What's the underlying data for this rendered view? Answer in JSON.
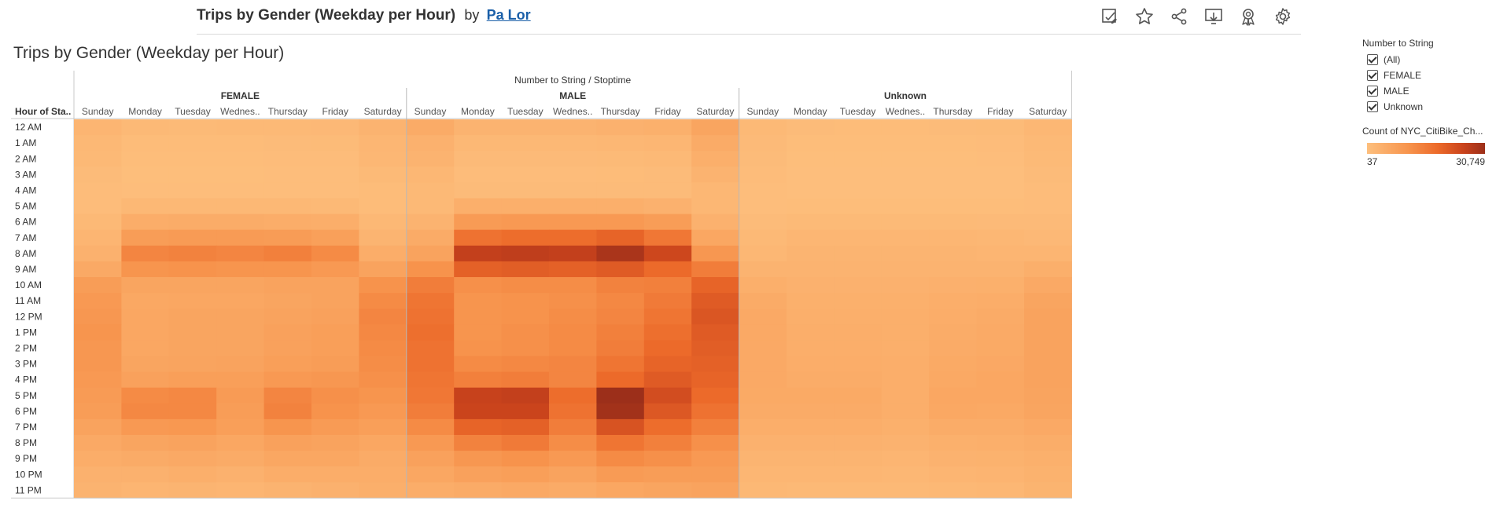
{
  "topbar": {
    "title": "Trips by Gender (Weekday per Hour)",
    "by": "by",
    "author": "Pa Lor"
  },
  "toolbar_icons": [
    "edit-sheet-icon",
    "star-icon",
    "share-icon",
    "download-icon",
    "metrics-icon",
    "settings-icon"
  ],
  "sheet_title": "Trips by Gender (Weekday per Hour)",
  "legend": {
    "filter_title": "Number to String",
    "items": [
      "(All)",
      "FEMALE",
      "MALE",
      "Unknown"
    ],
    "color_title": "Count of NYC_CitiBike_Ch...",
    "min_label": "37",
    "max_label": "30,749",
    "colors": [
      "#fdbf7d",
      "#f7944d",
      "#ec6a2a",
      "#c9431c",
      "#9c2f1a"
    ]
  },
  "chart_data": {
    "type": "heatmap",
    "column_header": "Number to String / Stoptime",
    "row_header": "Hour of Sta..",
    "groups": [
      "FEMALE",
      "MALE",
      "Unknown"
    ],
    "days": [
      "Sunday",
      "Monday",
      "Tuesday",
      "Wednes..",
      "Thursday",
      "Friday",
      "Saturday"
    ],
    "hours": [
      "12 AM",
      "1 AM",
      "2 AM",
      "3 AM",
      "4 AM",
      "5 AM",
      "6 AM",
      "7 AM",
      "8 AM",
      "9 AM",
      "10 AM",
      "11 AM",
      "12 PM",
      "1 PM",
      "2 PM",
      "3 PM",
      "4 PM",
      "5 PM",
      "6 PM",
      "7 PM",
      "8 PM",
      "9 PM",
      "10 PM",
      "11 PM"
    ],
    "color_range": [
      37,
      30749
    ],
    "values": {
      "FEMALE": [
        [
          2500,
          1500,
          1400,
          1500,
          1600,
          1700,
          3000
        ],
        [
          1800,
          900,
          900,
          900,
          1000,
          1100,
          2300
        ],
        [
          1500,
          600,
          600,
          600,
          700,
          800,
          2000
        ],
        [
          1000,
          400,
          400,
          400,
          450,
          500,
          1400
        ],
        [
          700,
          500,
          500,
          500,
          500,
          500,
          900
        ],
        [
          700,
          1800,
          1800,
          1800,
          1800,
          1600,
          900
        ],
        [
          1500,
          4500,
          4800,
          4700,
          4500,
          4200,
          1800
        ],
        [
          2500,
          8500,
          9000,
          9000,
          8800,
          7800,
          2800
        ],
        [
          3500,
          13500,
          14000,
          13500,
          14500,
          12500,
          4500
        ],
        [
          5500,
          10500,
          11000,
          10500,
          10500,
          9500,
          7000
        ],
        [
          8500,
          6500,
          6500,
          6500,
          7000,
          7000,
          11000
        ],
        [
          9500,
          5800,
          6000,
          6000,
          6500,
          7000,
          12500
        ],
        [
          10000,
          6000,
          6500,
          6500,
          7000,
          7500,
          13500
        ],
        [
          10500,
          6000,
          6500,
          6500,
          7500,
          8000,
          13000
        ],
        [
          10000,
          6000,
          6500,
          6500,
          7500,
          8000,
          12500
        ],
        [
          10000,
          6500,
          6800,
          7000,
          8000,
          8500,
          12000
        ],
        [
          9500,
          7500,
          8000,
          8000,
          9500,
          10000,
          11500
        ],
        [
          9000,
          12500,
          13000,
          9000,
          13500,
          11500,
          10500
        ],
        [
          8500,
          13000,
          13000,
          8500,
          14000,
          11000,
          9500
        ],
        [
          7000,
          9500,
          9800,
          8000,
          10500,
          9000,
          8000
        ],
        [
          5500,
          6500,
          7000,
          6000,
          7500,
          7000,
          6000
        ],
        [
          4500,
          5000,
          5500,
          5000,
          6000,
          6000,
          5000
        ],
        [
          3500,
          3500,
          4000,
          3500,
          4500,
          4500,
          4500
        ],
        [
          3000,
          2500,
          2800,
          2500,
          3000,
          3500,
          4000
        ]
      ],
      "MALE": [
        [
          5000,
          3000,
          3000,
          3000,
          3500,
          3800,
          6500
        ],
        [
          3500,
          1800,
          1800,
          1800,
          2000,
          2200,
          5000
        ],
        [
          3000,
          1200,
          1200,
          1200,
          1300,
          1500,
          4000
        ],
        [
          2000,
          800,
          800,
          800,
          900,
          1000,
          3000
        ],
        [
          1500,
          1000,
          1000,
          1000,
          1000,
          1000,
          2000
        ],
        [
          1500,
          4000,
          4000,
          4000,
          4000,
          3500,
          2000
        ],
        [
          3000,
          9000,
          9500,
          9500,
          9500,
          8500,
          3500
        ],
        [
          5000,
          17000,
          18000,
          18000,
          19500,
          16000,
          6000
        ],
        [
          7000,
          26000,
          26500,
          26000,
          29000,
          24500,
          10000
        ],
        [
          11000,
          20000,
          20500,
          20000,
          21000,
          18500,
          15000
        ],
        [
          15000,
          11500,
          12000,
          12000,
          14000,
          14500,
          19500
        ],
        [
          16500,
          10500,
          11000,
          11500,
          13000,
          15500,
          21000
        ],
        [
          17000,
          10500,
          11000,
          12000,
          13500,
          16500,
          22000
        ],
        [
          17500,
          10500,
          11500,
          12500,
          14500,
          17500,
          21000
        ],
        [
          17000,
          11000,
          11500,
          12500,
          15000,
          18500,
          20500
        ],
        [
          17000,
          12500,
          13000,
          13500,
          16500,
          19500,
          20000
        ],
        [
          16500,
          14500,
          15000,
          13500,
          18500,
          21000,
          19500
        ],
        [
          16000,
          25500,
          26000,
          18000,
          30749,
          23500,
          18500
        ],
        [
          15000,
          25000,
          25000,
          17000,
          30000,
          21500,
          17000
        ],
        [
          12500,
          19500,
          20000,
          15000,
          22500,
          18000,
          14500
        ],
        [
          9500,
          14000,
          15500,
          12000,
          16500,
          14500,
          11500
        ],
        [
          7500,
          10000,
          11000,
          9500,
          12500,
          11500,
          9500
        ],
        [
          6000,
          7500,
          8000,
          7000,
          9000,
          8500,
          8500
        ],
        [
          4500,
          5000,
          5500,
          5000,
          6000,
          6500,
          7000
        ]
      ],
      "Unknown": [
        [
          1600,
          1000,
          900,
          900,
          1000,
          1100,
          2000
        ],
        [
          1200,
          600,
          600,
          600,
          600,
          700,
          1500
        ],
        [
          1000,
          400,
          400,
          400,
          400,
          500,
          1300
        ],
        [
          700,
          300,
          300,
          300,
          300,
          350,
          1000
        ],
        [
          500,
          300,
          300,
          300,
          300,
          300,
          700
        ],
        [
          500,
          600,
          600,
          600,
          600,
          600,
          700
        ],
        [
          1000,
          1300,
          1300,
          1300,
          1300,
          1200,
          1200
        ],
        [
          1500,
          2200,
          2200,
          2200,
          2200,
          2000,
          1700
        ],
        [
          2000,
          2800,
          2800,
          2800,
          2800,
          2600,
          2500
        ],
        [
          3000,
          3000,
          3000,
          3000,
          3000,
          3000,
          4000
        ],
        [
          4000,
          3500,
          3500,
          3500,
          3700,
          3800,
          5500
        ],
        [
          5000,
          3800,
          3800,
          3800,
          4200,
          4500,
          6500
        ],
        [
          5500,
          4000,
          4000,
          4000,
          4500,
          5000,
          7000
        ],
        [
          5500,
          4200,
          4200,
          4000,
          4800,
          5200,
          7000
        ],
        [
          5500,
          4300,
          4300,
          4000,
          5000,
          5400,
          7000
        ],
        [
          5500,
          4500,
          4500,
          4200,
          5300,
          5700,
          7000
        ],
        [
          5500,
          4800,
          4800,
          4200,
          5600,
          6000,
          7000
        ],
        [
          5300,
          5300,
          5300,
          4400,
          6000,
          6000,
          6800
        ],
        [
          5000,
          5000,
          5000,
          4200,
          5800,
          5600,
          6500
        ],
        [
          4200,
          4300,
          4300,
          3800,
          4800,
          4800,
          5500
        ],
        [
          3500,
          3500,
          3500,
          3200,
          3900,
          4000,
          4600
        ],
        [
          2800,
          2800,
          2800,
          2600,
          3200,
          3300,
          3900
        ],
        [
          2300,
          2200,
          2200,
          2100,
          2500,
          2700,
          3400
        ],
        [
          1900,
          1600,
          1600,
          1500,
          1900,
          2100,
          2900
        ]
      ]
    }
  }
}
